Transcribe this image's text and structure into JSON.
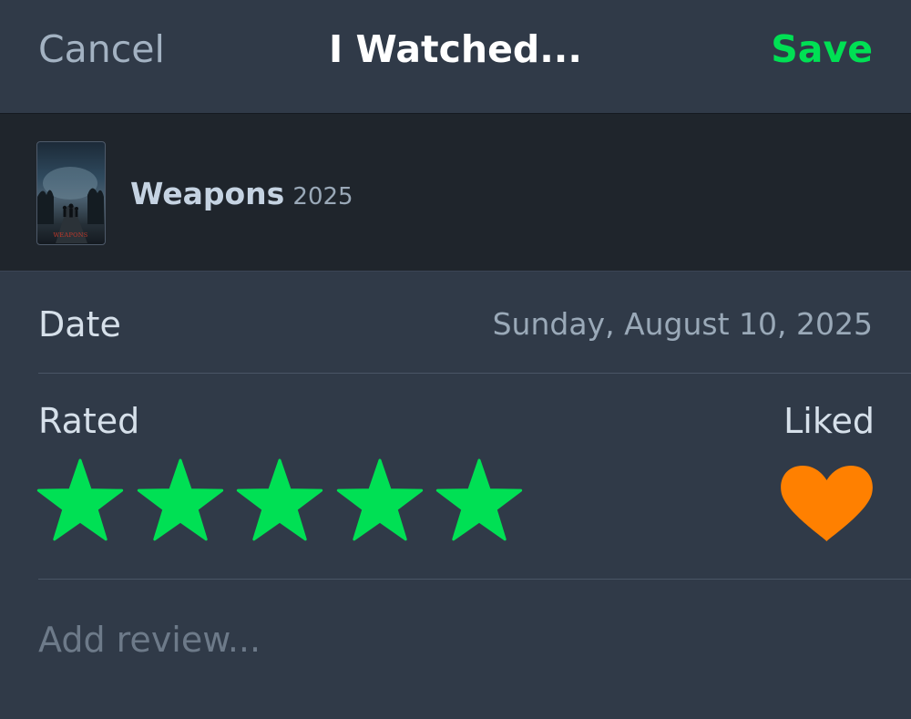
{
  "header": {
    "cancel_label": "Cancel",
    "title": "I Watched...",
    "save_label": "Save"
  },
  "film": {
    "title": "Weapons",
    "year": "2025",
    "poster_text": "WEAPONS"
  },
  "date": {
    "label": "Date",
    "value": "Sunday, August 10, 2025"
  },
  "rating": {
    "label": "Rated",
    "stars": 5,
    "max_stars": 5
  },
  "liked": {
    "label": "Liked",
    "value": true
  },
  "review": {
    "placeholder": "Add review..."
  },
  "colors": {
    "background": "#303a48",
    "accent_green": "#00e054",
    "heart_orange": "#ff8000",
    "film_row_bg": "#1f252c"
  }
}
